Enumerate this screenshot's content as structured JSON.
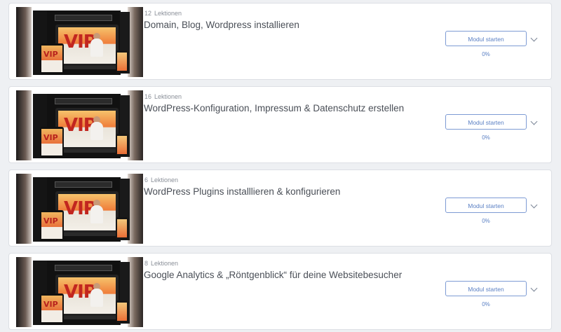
{
  "modules": [
    {
      "lesson_count": "12",
      "lesson_word": "Lektionen",
      "title": "Domain, Blog, Wordpress installieren",
      "button_label": "Modul starten",
      "progress": "0%",
      "thumbnail_icon": "vip-course-product-image",
      "thumbnail_text": "VIP"
    },
    {
      "lesson_count": "16",
      "lesson_word": "Lektionen",
      "title": "WordPress-Konfiguration, Impressum & Datenschutz erstellen",
      "button_label": "Modul starten",
      "progress": "0%",
      "thumbnail_icon": "vip-course-product-image",
      "thumbnail_text": "VIP"
    },
    {
      "lesson_count": "6",
      "lesson_word": "Lektionen",
      "title": "WordPress Plugins installlieren & konfigurieren",
      "button_label": "Modul starten",
      "progress": "0%",
      "thumbnail_icon": "vip-course-product-image",
      "thumbnail_text": "VIP"
    },
    {
      "lesson_count": "8",
      "lesson_word": "Lektionen",
      "title": "Google Analytics & „Röntgenblick“ für deine Websitebesucher",
      "button_label": "Modul starten",
      "progress": "0%",
      "thumbnail_icon": "vip-course-product-image",
      "thumbnail_text": "VIP"
    }
  ],
  "colors": {
    "accent": "#5b80c4",
    "card_border": "#dcdfe4",
    "page_bg": "#eef0f3"
  }
}
